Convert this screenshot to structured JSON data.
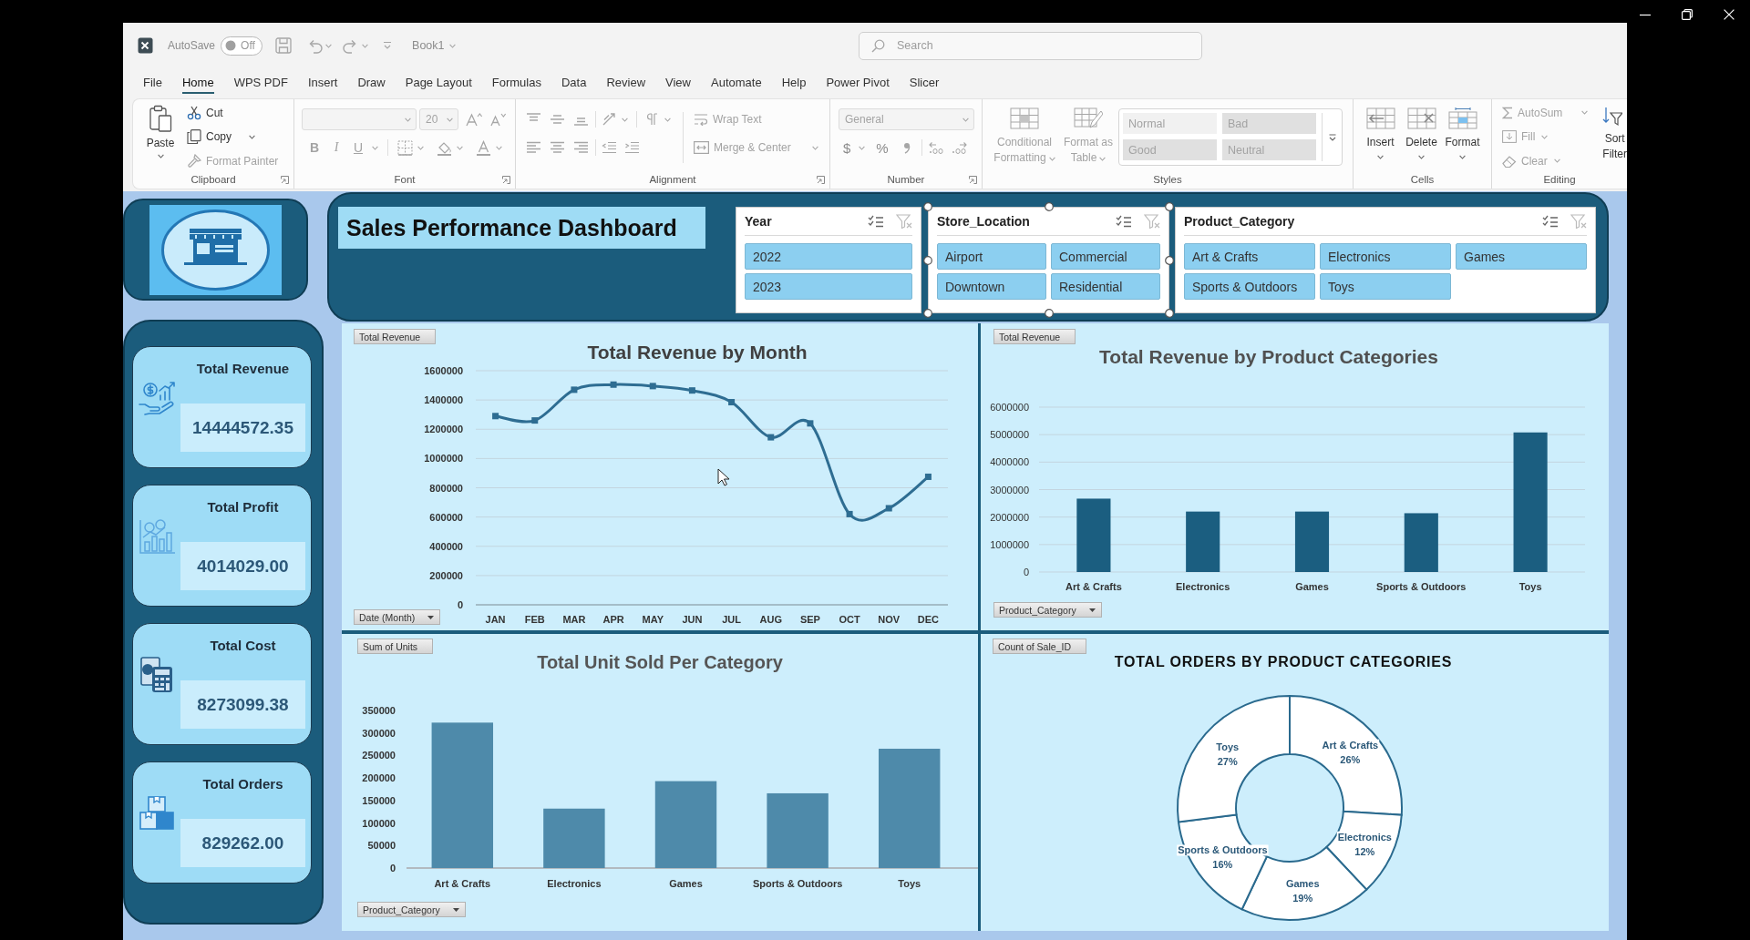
{
  "title_bar": {
    "autosave": {
      "label": "AutoSave",
      "toggle": "Off",
      "on": false
    },
    "document": "Book1",
    "search": {
      "placeholder": "Search"
    }
  },
  "menu_tabs": [
    {
      "label": "File",
      "selected": false
    },
    {
      "label": "Home",
      "selected": true
    },
    {
      "label": "WPS PDF",
      "selected": false
    },
    {
      "label": "Insert",
      "selected": false
    },
    {
      "label": "Draw",
      "selected": false
    },
    {
      "label": "Page Layout",
      "selected": false
    },
    {
      "label": "Formulas",
      "selected": false
    },
    {
      "label": "Data",
      "selected": false
    },
    {
      "label": "Review",
      "selected": false
    },
    {
      "label": "View",
      "selected": false
    },
    {
      "label": "Automate",
      "selected": false
    },
    {
      "label": "Help",
      "selected": false
    },
    {
      "label": "Power Pivot",
      "selected": false
    },
    {
      "label": "Slicer",
      "selected": false
    }
  ],
  "ribbon": {
    "clipboard": {
      "label": "Clipboard",
      "paste": {
        "label": "Paste",
        "disabled": false
      },
      "cut": {
        "label": "Cut",
        "disabled": false
      },
      "copy": {
        "label": "Copy",
        "disabled": false
      },
      "format_painter": {
        "label": "Format Painter",
        "disabled": true
      }
    },
    "font": {
      "label": "Font",
      "font_size": "20",
      "bold": "B",
      "italic": "I",
      "underline": "U",
      "disabled": true
    },
    "alignment": {
      "label": "Alignment",
      "wrap_text": {
        "label": "Wrap Text",
        "disabled": true
      },
      "merge_center": {
        "label": "Merge & Center",
        "disabled": true
      }
    },
    "number": {
      "label": "Number",
      "format": "General",
      "currency": "$",
      "percent": "%",
      "disabled": true
    },
    "styles": {
      "label": "Styles",
      "conditional_formatting": {
        "label": "Conditional Formatting",
        "disabled": true
      },
      "format_as_table": {
        "label": "Format as Table",
        "disabled": true
      },
      "cell_styles": [
        {
          "label": "Normal",
          "disabled": true
        },
        {
          "label": "Bad",
          "disabled": true
        },
        {
          "label": "Good",
          "disabled": true
        },
        {
          "label": "Neutral",
          "disabled": true
        }
      ]
    },
    "cells": {
      "label": "Cells",
      "buttons": [
        {
          "label": "Insert",
          "disabled": false
        },
        {
          "label": "Delete",
          "disabled": false
        },
        {
          "label": "Format",
          "disabled": false
        }
      ]
    },
    "editing": {
      "label": "Editing",
      "buttons": [
        {
          "label": "AutoSum",
          "disabled": true
        },
        {
          "label": "Fill",
          "disabled": true
        },
        {
          "label": "Clear",
          "disabled": true
        }
      ],
      "sort_filter": {
        "lines": [
          "Sort",
          "Filter"
        ],
        "disabled": false
      }
    }
  },
  "dashboard": {
    "title": "Sales Performance Dashboard",
    "slicers": [
      {
        "header": "Year",
        "selected": false,
        "items": [
          {
            "label": "2022",
            "selected": true
          },
          {
            "label": "2023",
            "selected": true
          }
        ]
      },
      {
        "header": "Store_Location",
        "selected": true,
        "items": [
          {
            "label": "Airport",
            "selected": true
          },
          {
            "label": "Commercial",
            "selected": true
          },
          {
            "label": "Downtown",
            "selected": true
          },
          {
            "label": "Residential",
            "selected": true
          }
        ]
      },
      {
        "header": "Product_Category",
        "selected": false,
        "items": [
          {
            "label": "Art & Crafts",
            "selected": true
          },
          {
            "label": "Electronics",
            "selected": true
          },
          {
            "label": "Games",
            "selected": true
          },
          {
            "label": "Sports & Outdoors",
            "selected": true
          },
          {
            "label": "Toys",
            "selected": true
          }
        ]
      }
    ],
    "kpis": [
      {
        "title": "Total Revenue",
        "value": "14444572.35"
      },
      {
        "title": "Total Profit",
        "value": "4014029.00"
      },
      {
        "title": "Total Cost",
        "value": "8273099.38"
      },
      {
        "title": "Total Orders",
        "value": "829262.00"
      }
    ],
    "charts": [
      {
        "value_button": "Total Revenue",
        "axis_button": "Date (Month)",
        "chart_data": {
          "type": "line",
          "title": "Total Revenue by Month",
          "categories": [
            "JAN",
            "FEB",
            "MAR",
            "APR",
            "MAY",
            "JUN",
            "JUL",
            "AUG",
            "SEP",
            "OCT",
            "NOV",
            "DEC"
          ],
          "values": [
            1290000,
            1260000,
            1470000,
            1505000,
            1495000,
            1465000,
            1385000,
            1145000,
            1240000,
            620000,
            660000,
            875000
          ],
          "color": "#2e6d92",
          "ylim": [
            0,
            1600000
          ],
          "yticks": [
            0,
            200000,
            400000,
            600000,
            800000,
            1000000,
            1200000,
            1400000,
            1600000
          ],
          "grid": true,
          "marker": "square"
        }
      },
      {
        "value_button": "Total Revenue",
        "axis_button": "Product_Category",
        "chart_data": {
          "type": "bar",
          "title": "Total Revenue by Product Categories",
          "categories": [
            "Art & Crafts",
            "Electronics",
            "Games",
            "Sports & Outdoors",
            "Toys"
          ],
          "values": [
            2670000,
            2200000,
            2200000,
            2140000,
            5080000
          ],
          "color": "#1b5e80",
          "ylim": [
            0,
            6000000
          ],
          "yticks": [
            0,
            1000000,
            2000000,
            3000000,
            4000000,
            5000000,
            6000000
          ],
          "grid": true
        }
      },
      {
        "value_button": "Sum of Units",
        "axis_button": "Product_Category",
        "chart_data": {
          "type": "bar",
          "title": "Total Unit Sold Per Category",
          "categories": [
            "Art & Crafts",
            "Electronics",
            "Games",
            "Sports & Outdoors",
            "Toys"
          ],
          "values": [
            323000,
            132000,
            193000,
            166000,
            265000
          ],
          "color": "#4e8aaa",
          "ylim": [
            0,
            350000
          ],
          "yticks": [
            0,
            50000,
            100000,
            150000,
            200000,
            250000,
            300000,
            350000
          ]
        }
      },
      {
        "value_button": "Count of Sale_ID",
        "chart_data": {
          "type": "donut",
          "title": "TOTAL ORDERS BY PRODUCT CATEGORIES",
          "categories": [
            "Art & Crafts",
            "Electronics",
            "Games",
            "Sports & Outdoors",
            "Toys"
          ],
          "values": [
            26,
            12,
            19,
            16,
            27
          ],
          "value_labels": [
            "26%",
            "12%",
            "19%",
            "16%",
            "27%"
          ],
          "color": "#ffffff"
        }
      }
    ]
  }
}
